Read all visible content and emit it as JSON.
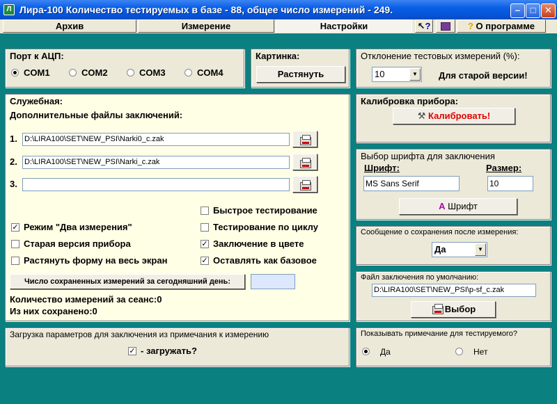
{
  "window": {
    "title": "Лира-100   Количество тестируемых в базе - 88, общее число измерений - 249.",
    "app_icon_text": "Л"
  },
  "tabs": [
    {
      "label": "Архив",
      "active": false
    },
    {
      "label": "Измерение",
      "active": false
    },
    {
      "label": "Настройки",
      "active": true
    }
  ],
  "toolbar": {
    "help_label": "?",
    "about_label": "О программе"
  },
  "port": {
    "title": "Порт к АЦП:",
    "options": [
      "COM1",
      "COM2",
      "COM3",
      "COM4"
    ],
    "selected": "COM1"
  },
  "picture": {
    "title": "Картинка:",
    "button": "Растянуть"
  },
  "deviation": {
    "title": "Отклонение тестовых измерений (%):",
    "value": "10",
    "note": "Для старой версии!"
  },
  "service": {
    "title": "Служебная:",
    "files_label": "Дополнительные файлы заключений:",
    "files": [
      {
        "num": "1.",
        "path": "D:\\LIRA100\\SET\\NEW_PSI\\Narki0_c.zak"
      },
      {
        "num": "2.",
        "path": "D:\\LIRA100\\SET\\NEW_PSI\\Narki_c.zak"
      },
      {
        "num": "3.",
        "path": ""
      }
    ],
    "checks_left": [
      {
        "label": "Режим \"Два измерения\"",
        "checked": true
      },
      {
        "label": "Старая версия прибора",
        "checked": false
      },
      {
        "label": "Растянуть форму на весь экран",
        "checked": false
      }
    ],
    "checks_right": [
      {
        "label": "Быстрое тестирование",
        "checked": false
      },
      {
        "label": "Тестирование по циклу",
        "checked": false
      },
      {
        "label": "Заключение в цвете",
        "checked": true
      },
      {
        "label": "Оставлять как базовое",
        "checked": true
      }
    ],
    "saved_today_button": "Число сохраненных измерений за сегодняшний день:",
    "saved_today_value": "",
    "session_count": "Количество измерений за сеанс:0",
    "saved_count": "Из них сохранено:0"
  },
  "load_params": {
    "title": "Загрузка параметров для заключения из примечания к измерению",
    "check_label": " - загружать?",
    "checked": true
  },
  "calibration": {
    "title": "Калибровка прибора:",
    "button": "Калибровать!",
    "button_color": "#e00000"
  },
  "font_select": {
    "title": "Выбор шрифта для заключения",
    "font_label": "Шрифт:",
    "size_label": "Размер:",
    "font_value": "MS Sans Serif",
    "size_value": "10",
    "button": "Шрифт"
  },
  "save_msg": {
    "title": "Сообщение о сохранения после измерения:",
    "value": "Да"
  },
  "default_file": {
    "title": "Файл заключения по умолчанию:",
    "path": "D:\\LIRA100\\SET\\NEW_PSI\\p-sf_c.zak",
    "button": "Выбор"
  },
  "show_note": {
    "title": "Показывать примечание для тестируемого?",
    "options": [
      "Да",
      "Нет"
    ],
    "selected": "Да"
  }
}
